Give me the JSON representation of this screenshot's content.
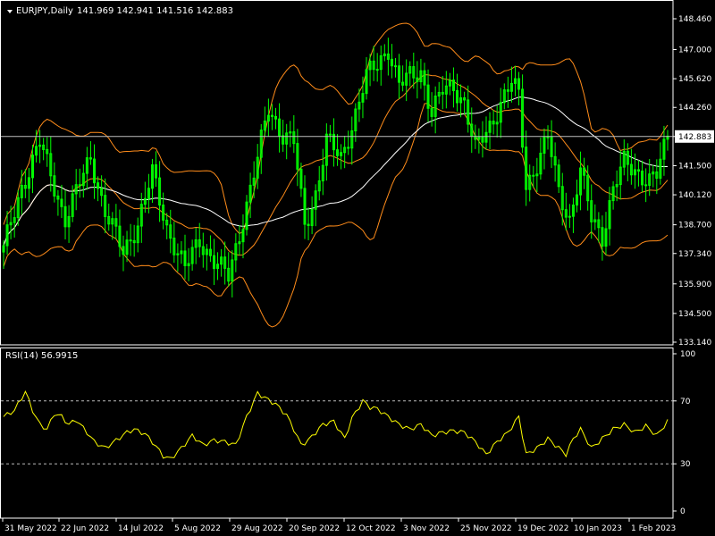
{
  "header": {
    "symbol_timeframe": "EURJPY,Daily",
    "ohlc": "141.969 142.941 141.516 142.883"
  },
  "colors": {
    "background": "#000000",
    "candle": "#00ff00",
    "bollinger": "#ff8c1a",
    "moving_average": "#ffffff",
    "rsi": "#ffff00",
    "axis": "#ffffff"
  },
  "chart_data": [
    {
      "type": "candlestick",
      "title": "EURJPY,Daily",
      "price_ticks": [
        "148.460",
        "147.000",
        "145.620",
        "144.260",
        "142.883",
        "141.500",
        "140.120",
        "138.700",
        "137.340",
        "135.900",
        "134.500",
        "133.140"
      ],
      "current_price": "142.883",
      "ylim": [
        133.0,
        149.2
      ],
      "x_labels": [
        "31 May 2022",
        "22 Jun 2022",
        "14 Jul 2022",
        "5 Aug 2022",
        "29 Aug 2022",
        "20 Sep 2022",
        "12 Oct 2022",
        "3 Nov 2022",
        "25 Nov 2022",
        "19 Dec 2022",
        "10 Jan 2023",
        "1 Feb 2023"
      ],
      "close_series": [
        {
          "i": 0,
          "c": 137.5
        },
        {
          "i": 5,
          "c": 140.5
        },
        {
          "i": 10,
          "c": 142.6
        },
        {
          "i": 13,
          "c": 141.0
        },
        {
          "i": 17,
          "c": 139.0
        },
        {
          "i": 20,
          "c": 140.2
        },
        {
          "i": 24,
          "c": 141.9
        },
        {
          "i": 28,
          "c": 139.3
        },
        {
          "i": 33,
          "c": 137.4
        },
        {
          "i": 37,
          "c": 138.8
        },
        {
          "i": 41,
          "c": 141.1
        },
        {
          "i": 45,
          "c": 138.6
        },
        {
          "i": 50,
          "c": 136.6
        },
        {
          "i": 54,
          "c": 138.0
        },
        {
          "i": 58,
          "c": 137.0
        },
        {
          "i": 62,
          "c": 136.2
        },
        {
          "i": 66,
          "c": 139.0
        },
        {
          "i": 70,
          "c": 141.8
        },
        {
          "i": 73,
          "c": 144.2
        },
        {
          "i": 77,
          "c": 143.0
        },
        {
          "i": 80,
          "c": 142.6
        },
        {
          "i": 83,
          "c": 138.6
        },
        {
          "i": 86,
          "c": 140.2
        },
        {
          "i": 89,
          "c": 142.7
        },
        {
          "i": 93,
          "c": 141.8
        },
        {
          "i": 97,
          "c": 144.0
        },
        {
          "i": 100,
          "c": 145.7
        },
        {
          "i": 103,
          "c": 146.3
        },
        {
          "i": 106,
          "c": 147.1
        },
        {
          "i": 109,
          "c": 145.3
        },
        {
          "i": 112,
          "c": 145.7
        },
        {
          "i": 115,
          "c": 146.0
        },
        {
          "i": 118,
          "c": 144.0
        },
        {
          "i": 121,
          "c": 145.0
        },
        {
          "i": 124,
          "c": 145.3
        },
        {
          "i": 127,
          "c": 144.5
        },
        {
          "i": 130,
          "c": 142.2
        },
        {
          "i": 134,
          "c": 143.4
        },
        {
          "i": 137,
          "c": 144.5
        },
        {
          "i": 140,
          "c": 145.4
        },
        {
          "i": 142,
          "c": 144.8
        },
        {
          "i": 144,
          "c": 140.6
        },
        {
          "i": 147,
          "c": 141.6
        },
        {
          "i": 150,
          "c": 142.8
        },
        {
          "i": 153,
          "c": 140.3
        },
        {
          "i": 156,
          "c": 139.0
        },
        {
          "i": 159,
          "c": 141.2
        },
        {
          "i": 162,
          "c": 139.0
        },
        {
          "i": 165,
          "c": 138.2
        },
        {
          "i": 168,
          "c": 140.4
        },
        {
          "i": 171,
          "c": 141.6
        },
        {
          "i": 175,
          "c": 141.2
        },
        {
          "i": 178,
          "c": 140.8
        },
        {
          "i": 180,
          "c": 141.0
        },
        {
          "i": 183,
          "c": 142.9
        }
      ],
      "indicators": [
        "Bollinger Bands",
        "Moving Average"
      ]
    },
    {
      "type": "line",
      "title": "RSI(14) 56.9915",
      "ticks": [
        "100",
        "70",
        "30",
        "0"
      ],
      "levels": [
        70,
        30
      ],
      "ylim": [
        0,
        100
      ],
      "series": [
        {
          "name": "RSI(14)",
          "points": [
            {
              "i": 0,
              "v": 60
            },
            {
              "i": 3,
              "v": 64
            },
            {
              "i": 6,
              "v": 76
            },
            {
              "i": 8,
              "v": 64
            },
            {
              "i": 10,
              "v": 55
            },
            {
              "i": 12,
              "v": 52
            },
            {
              "i": 14,
              "v": 62
            },
            {
              "i": 16,
              "v": 60
            },
            {
              "i": 18,
              "v": 55
            },
            {
              "i": 20,
              "v": 58
            },
            {
              "i": 23,
              "v": 50
            },
            {
              "i": 25,
              "v": 44
            },
            {
              "i": 28,
              "v": 40
            },
            {
              "i": 31,
              "v": 45
            },
            {
              "i": 34,
              "v": 50
            },
            {
              "i": 36,
              "v": 52
            },
            {
              "i": 39,
              "v": 49
            },
            {
              "i": 41,
              "v": 44
            },
            {
              "i": 44,
              "v": 35
            },
            {
              "i": 46,
              "v": 33
            },
            {
              "i": 49,
              "v": 40
            },
            {
              "i": 52,
              "v": 48
            },
            {
              "i": 55,
              "v": 42
            },
            {
              "i": 58,
              "v": 45
            },
            {
              "i": 61,
              "v": 44
            },
            {
              "i": 64,
              "v": 42
            },
            {
              "i": 67,
              "v": 60
            },
            {
              "i": 70,
              "v": 75
            },
            {
              "i": 72,
              "v": 72
            },
            {
              "i": 75,
              "v": 68
            },
            {
              "i": 78,
              "v": 61
            },
            {
              "i": 80,
              "v": 52
            },
            {
              "i": 82,
              "v": 42
            },
            {
              "i": 84,
              "v": 45
            },
            {
              "i": 86,
              "v": 50
            },
            {
              "i": 88,
              "v": 55
            },
            {
              "i": 91,
              "v": 57
            },
            {
              "i": 94,
              "v": 46
            },
            {
              "i": 96,
              "v": 59
            },
            {
              "i": 99,
              "v": 70
            },
            {
              "i": 101,
              "v": 66
            },
            {
              "i": 103,
              "v": 65
            },
            {
              "i": 106,
              "v": 60
            },
            {
              "i": 109,
              "v": 55
            },
            {
              "i": 112,
              "v": 52
            },
            {
              "i": 115,
              "v": 55
            },
            {
              "i": 118,
              "v": 48
            },
            {
              "i": 121,
              "v": 50
            },
            {
              "i": 124,
              "v": 51
            },
            {
              "i": 127,
              "v": 50
            },
            {
              "i": 130,
              "v": 44
            },
            {
              "i": 133,
              "v": 36
            },
            {
              "i": 136,
              "v": 44
            },
            {
              "i": 139,
              "v": 50
            },
            {
              "i": 142,
              "v": 60
            },
            {
              "i": 144,
              "v": 36
            },
            {
              "i": 147,
              "v": 40
            },
            {
              "i": 150,
              "v": 46
            },
            {
              "i": 153,
              "v": 40
            },
            {
              "i": 155,
              "v": 36
            },
            {
              "i": 157,
              "v": 46
            },
            {
              "i": 159,
              "v": 52
            },
            {
              "i": 162,
              "v": 40
            },
            {
              "i": 165,
              "v": 46
            },
            {
              "i": 168,
              "v": 52
            },
            {
              "i": 171,
              "v": 55
            },
            {
              "i": 174,
              "v": 50
            },
            {
              "i": 177,
              "v": 54
            },
            {
              "i": 180,
              "v": 48
            },
            {
              "i": 183,
              "v": 57
            }
          ]
        }
      ]
    }
  ]
}
